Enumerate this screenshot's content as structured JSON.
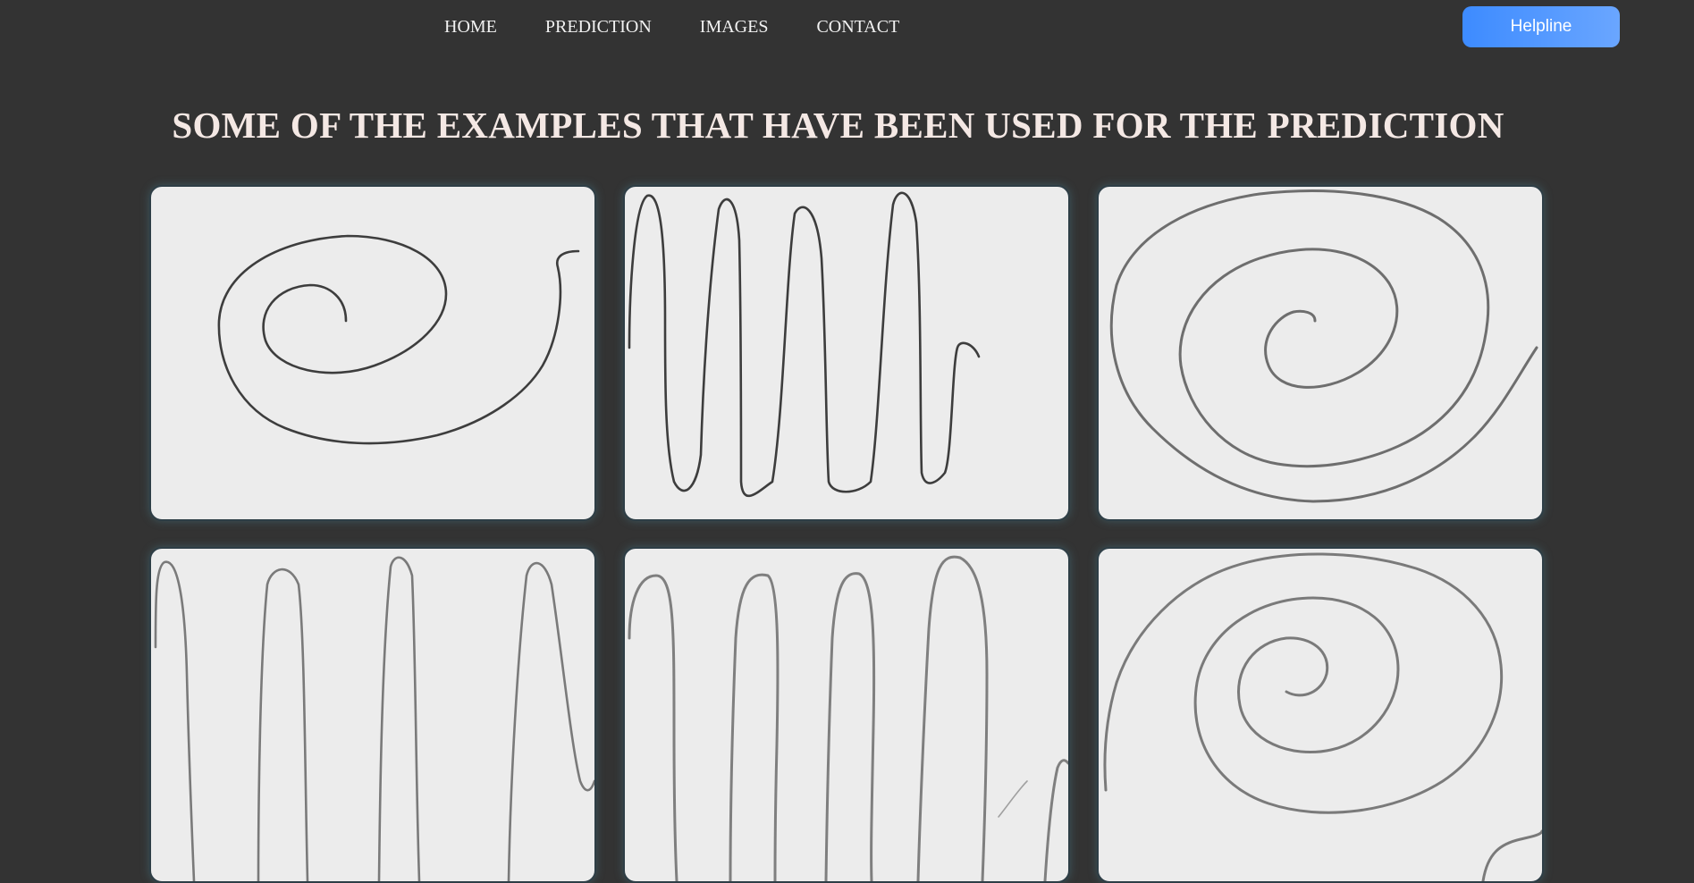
{
  "nav": {
    "links": [
      "HOME",
      "PREDICTION",
      "IMAGES",
      "CONTACT"
    ],
    "helpline_label": "Helpline"
  },
  "page": {
    "title": "SOME OF THE EXAMPLES THAT HAVE BEEN USED FOR THE PREDICTION"
  },
  "gallery": {
    "items": [
      {
        "drawing": "spiral"
      },
      {
        "drawing": "wave"
      },
      {
        "drawing": "spiral"
      },
      {
        "drawing": "wave"
      },
      {
        "drawing": "wave"
      },
      {
        "drawing": "spiral"
      }
    ]
  },
  "colors": {
    "background": "#333333",
    "heading": "#f4e8e4",
    "helpline_start": "#3d8bff",
    "helpline_end": "#6aa6ff",
    "card_paper": "#ececec",
    "pencil_dark": "#3a3a3a",
    "pencil_light": "#7a7a7a"
  }
}
